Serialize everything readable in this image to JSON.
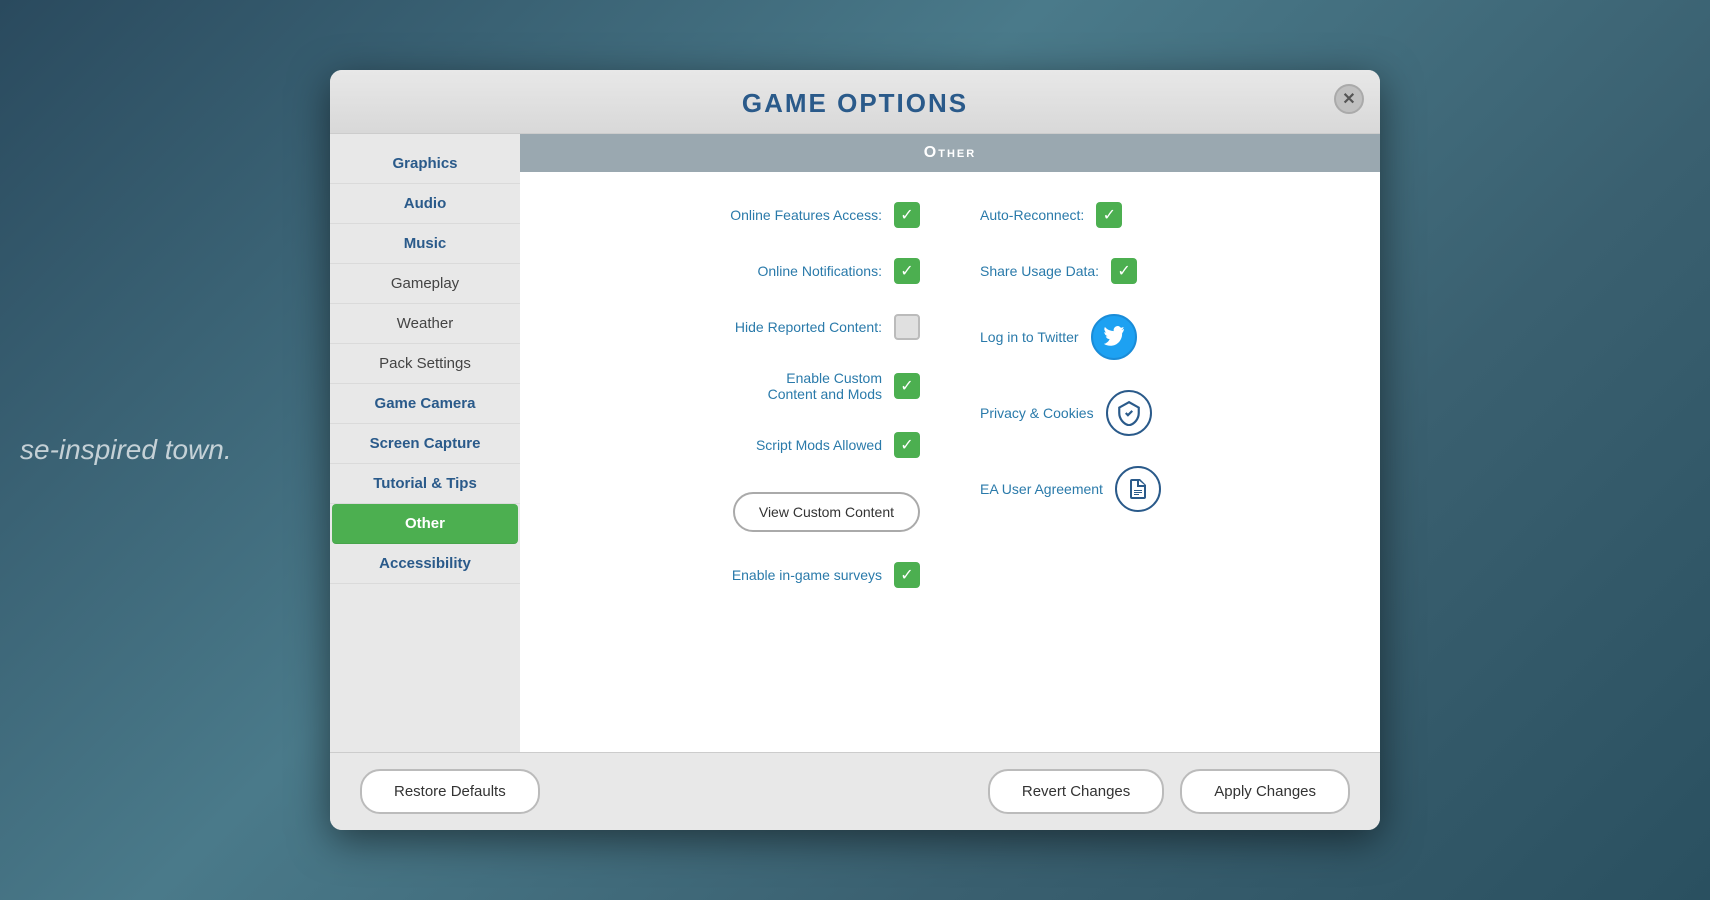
{
  "background": {
    "text": "se-inspired town."
  },
  "modal": {
    "title": "Game Options",
    "close_label": "✕"
  },
  "sidebar": {
    "items": [
      {
        "id": "graphics",
        "label": "Graphics",
        "bold": true,
        "active": false
      },
      {
        "id": "audio",
        "label": "Audio",
        "bold": true,
        "active": false
      },
      {
        "id": "music",
        "label": "Music",
        "bold": true,
        "active": false
      },
      {
        "id": "gameplay",
        "label": "Gameplay",
        "bold": false,
        "active": false
      },
      {
        "id": "weather",
        "label": "Weather",
        "bold": false,
        "active": false
      },
      {
        "id": "pack-settings",
        "label": "Pack Settings",
        "bold": false,
        "active": false
      },
      {
        "id": "game-camera",
        "label": "Game Camera",
        "bold": true,
        "active": false
      },
      {
        "id": "screen-capture",
        "label": "Screen Capture",
        "bold": true,
        "active": false
      },
      {
        "id": "tutorial-tips",
        "label": "Tutorial & Tips",
        "bold": true,
        "active": false
      },
      {
        "id": "other",
        "label": "Other",
        "bold": true,
        "active": true
      },
      {
        "id": "accessibility",
        "label": "Accessibility",
        "bold": true,
        "active": false
      }
    ]
  },
  "content": {
    "header": "Other",
    "left_settings": [
      {
        "id": "online-features",
        "label": "Online Features Access:",
        "checked": true
      },
      {
        "id": "online-notifications",
        "label": "Online Notifications:",
        "checked": true
      },
      {
        "id": "hide-reported",
        "label": "Hide Reported Content:",
        "checked": false
      },
      {
        "id": "enable-custom-content",
        "label": "Enable Custom Content and Mods",
        "checked": true
      },
      {
        "id": "script-mods",
        "label": "Script Mods Allowed",
        "checked": true
      }
    ],
    "view_cc_button": "View Custom Content",
    "enable_surveys": {
      "label": "Enable in-game surveys",
      "checked": true
    },
    "right_settings": [
      {
        "id": "auto-reconnect",
        "label": "Auto-Reconnect:",
        "checked": true,
        "type": "checkbox"
      },
      {
        "id": "share-usage",
        "label": "Share Usage Data:",
        "checked": true,
        "type": "checkbox"
      },
      {
        "id": "log-twitter",
        "label": "Log in to Twitter",
        "type": "twitter"
      },
      {
        "id": "privacy-cookies",
        "label": "Privacy & Cookies",
        "type": "shield"
      },
      {
        "id": "ea-user-agreement",
        "label": "EA User Agreement",
        "type": "doc"
      }
    ]
  },
  "footer": {
    "restore_defaults": "Restore Defaults",
    "revert_changes": "Revert Changes",
    "apply_changes": "Apply Changes"
  }
}
